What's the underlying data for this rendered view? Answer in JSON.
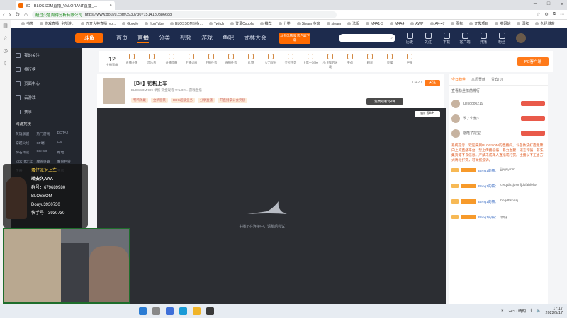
{
  "browser": {
    "tab_title": "8D - BLOSSOM直播_VALORANT直播_...",
    "url_secure": "超过火急周得分析有限公司",
    "url": "https://www.douyu.com/3930730?1514180386688",
    "extensions": [
      "☆",
      "⚙",
      "⧉",
      "⋯"
    ]
  },
  "bookmarks": [
    "书签",
    "游戏直播_全部游...",
    "五开大神直播_yo...",
    "Google",
    "YouTube",
    "BLOSSOM斗鱼...",
    "Twitch",
    "登录Csgola",
    "推荐",
    "分类",
    "Steam 多客",
    "steam",
    "法服",
    "M4A1-S",
    "M4A4",
    "AWP",
    "AK-47",
    "图标",
    "开发项目",
    "英网站",
    "深红",
    "久经城客"
  ],
  "header": {
    "logo": "斗鱼",
    "nav": [
      "首页",
      "直播",
      "分类",
      "视频",
      "游戏",
      "鱼吧",
      "武林大会"
    ],
    "download_label": "斗鱼电脑版\n客户端下载",
    "icons": [
      "历史",
      "关注",
      "下载",
      "客户端",
      "开播",
      "粉丝"
    ]
  },
  "sidebar": {
    "items": [
      "我的关注",
      "排行榜",
      "页面中心",
      "云游戏",
      "赛事"
    ],
    "section_title": "网游竞技",
    "grid": [
      "英雄联盟",
      "热门游戏",
      "DOTA2",
      "穿越火线",
      "CF端",
      "CS",
      "炉石传说",
      "CS:GO",
      "绝地",
      "lol云顶之弈",
      "魔兽争霸",
      "魔兽巨兽",
      "传奇",
      "梦幻",
      "王者"
    ]
  },
  "tools": {
    "level": "12",
    "level_label": "主播等级",
    "items": [
      "直播开关",
      "音乐台",
      "开播提醒",
      "主播订阅",
      "主播任务",
      "直播任务",
      "礼物",
      "火力全开",
      "全民任务",
      "上车一起玩",
      "小飞象的环境",
      "关荷",
      "粉丝",
      "荣耀",
      "更多"
    ],
    "pc_button": "PC客户端",
    "pc_sub": "主播端下载"
  },
  "room": {
    "title": "【B+】钻粉上车",
    "sub": "举报  赏金观看  VALOR...  游戏直播",
    "meta": "BLOSSOM  999",
    "tags": [
      "鸭鸭佩戴",
      "全新服装",
      "DDG超级业务",
      "分享直播",
      "开直播拿公会奖励"
    ],
    "fans": "13420",
    "follow": "关注",
    "mini_window": "窗口弹出",
    "mini_badge": "免费观看3分钟",
    "loading": "主播正在连接中，请稍后尝试"
  },
  "rightpanel": {
    "tabs": [
      "今日粉丝",
      "本周贡献",
      "贵宾(0)"
    ],
    "rank_header": "查看粉丝榜前排行",
    "ranks": [
      {
        "name": "juesooo0219"
      },
      {
        "name": "翠了个酱~"
      },
      {
        "name": "憨酷了挖宝"
      }
    ],
    "notice": "系统提示：欢迎来到BLOSSOM的直播间。斗鱼依法打造健康向上的直播平台，禁止传播低俗、暴力血腥、谣言诈骗、非法集资等不良信息。严禁未成年人直播或打赏。主播以不正当方式诱导打赏，可举报投诉。",
    "chats": [
      {
        "user": "Beng1的铁：",
        "msg": "jjpgnymm"
      },
      {
        "user": "Beng1的铁：",
        "msg": "cwqjdhxjdsmfjdsfahfefw"
      },
      {
        "user": "Beng1的铁：",
        "msg": "bhgdhsnnsj"
      },
      {
        "user": "Beng1的铁：",
        "msg": "你好"
      }
    ]
  },
  "overlay": {
    "title": "蛋仔派对上车",
    "name": "瑶安久AAA",
    "lines": [
      "群号：679689980",
      "BLOSSOM",
      "Douyu3930730",
      "快手号：3930730"
    ]
  },
  "taskbar": {
    "weather": "24°C 晴朗",
    "time": "17:17",
    "date": "2022/5/17"
  }
}
